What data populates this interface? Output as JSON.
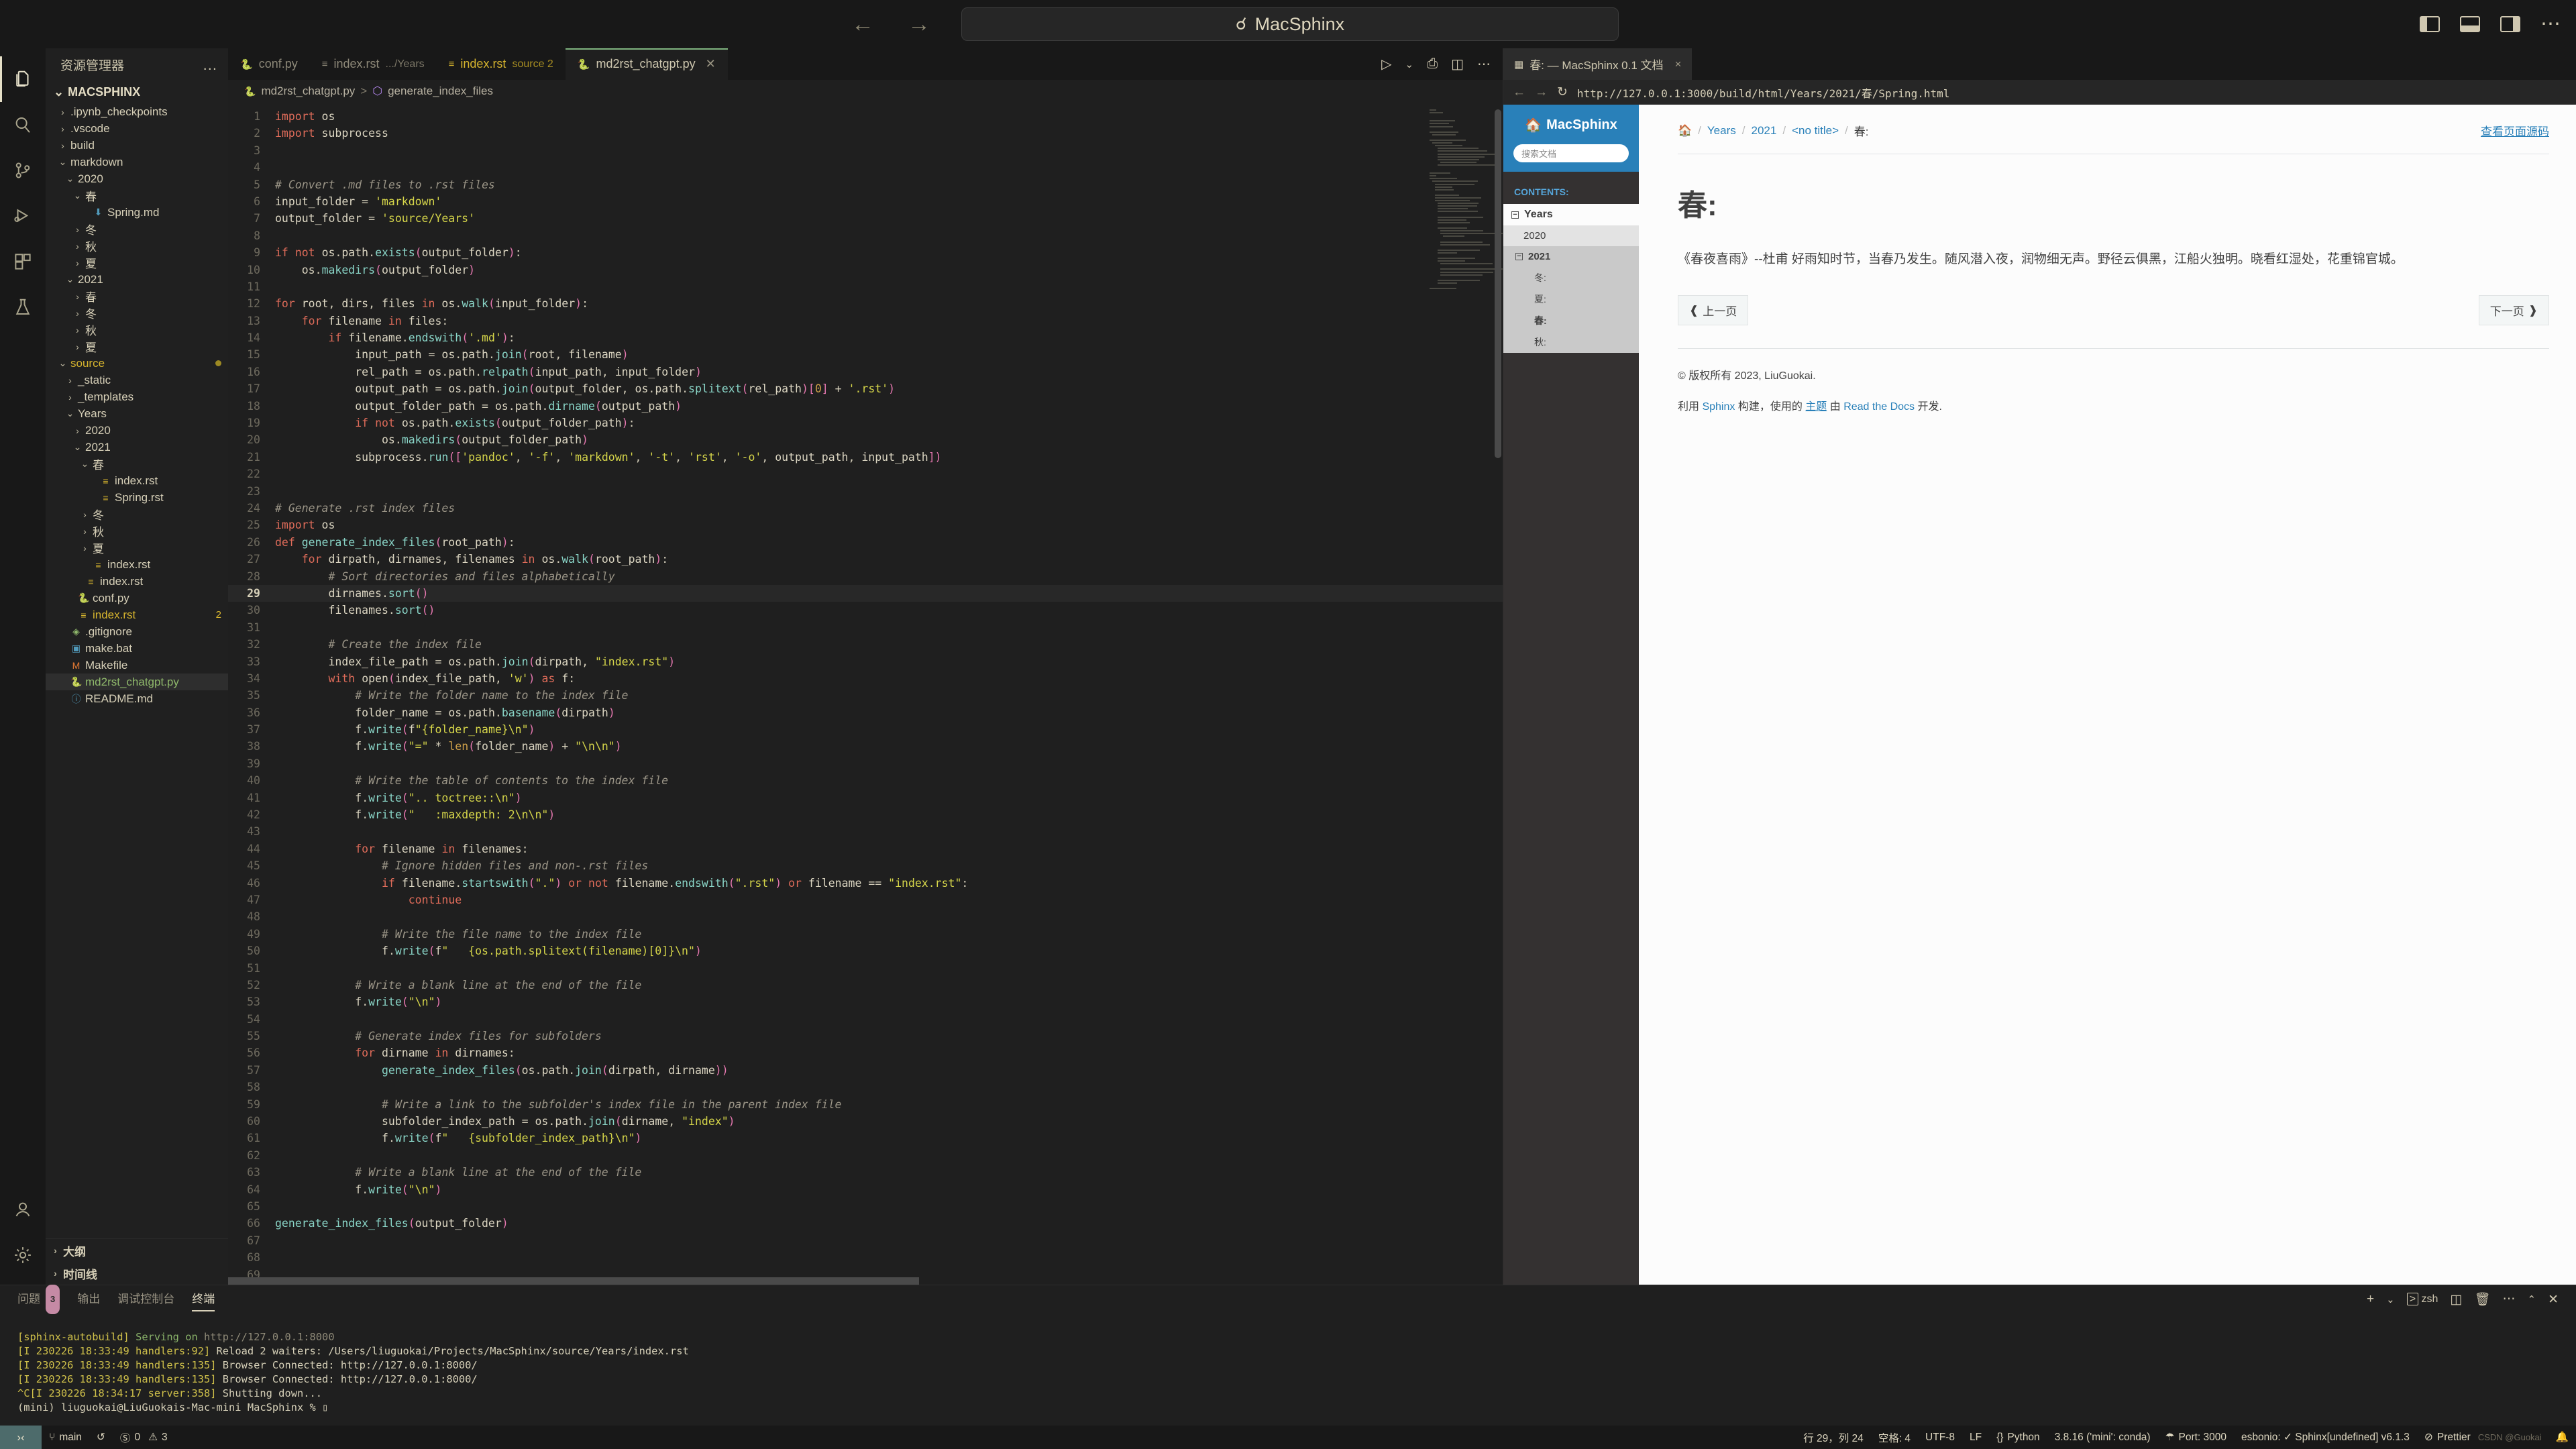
{
  "titlebar": {
    "back_icon": "back-arrow-icon",
    "forward_icon": "forward-arrow-icon",
    "search_placeholder": "MacSphinx",
    "search_icon": "search-icon"
  },
  "activitybar": {
    "items": [
      {
        "name": "explorer",
        "icon": "files-icon"
      },
      {
        "name": "search",
        "icon": "search-icon"
      },
      {
        "name": "source-control",
        "icon": "source-control-icon"
      },
      {
        "name": "run-debug",
        "icon": "run-debug-icon"
      },
      {
        "name": "extensions",
        "icon": "extensions-icon"
      },
      {
        "name": "testing",
        "icon": "beaker-icon"
      }
    ],
    "bottom": [
      {
        "name": "accounts",
        "icon": "account-icon"
      },
      {
        "name": "settings",
        "icon": "gear-icon"
      }
    ]
  },
  "explorer": {
    "title": "资源管理器",
    "more_label": "...",
    "root": "MACSPHINX",
    "tree": [
      {
        "label": ".ipynb_checkpoints",
        "kind": "folder",
        "depth": 1,
        "state": "collapsed"
      },
      {
        "label": ".vscode",
        "kind": "folder",
        "depth": 1,
        "state": "collapsed"
      },
      {
        "label": "build",
        "kind": "folder",
        "depth": 1,
        "state": "collapsed"
      },
      {
        "label": "markdown",
        "kind": "folder",
        "depth": 1,
        "state": "expanded"
      },
      {
        "label": "2020",
        "kind": "folder",
        "depth": 2,
        "state": "expanded"
      },
      {
        "label": "春",
        "kind": "folder",
        "depth": 3,
        "state": "expanded"
      },
      {
        "label": "Spring.md",
        "kind": "markdown",
        "depth": 4,
        "state": "file"
      },
      {
        "label": "冬",
        "kind": "folder",
        "depth": 3,
        "state": "collapsed"
      },
      {
        "label": "秋",
        "kind": "folder",
        "depth": 3,
        "state": "collapsed"
      },
      {
        "label": "夏",
        "kind": "folder",
        "depth": 3,
        "state": "collapsed"
      },
      {
        "label": "2021",
        "kind": "folder",
        "depth": 2,
        "state": "expanded"
      },
      {
        "label": "春",
        "kind": "folder",
        "depth": 3,
        "state": "collapsed"
      },
      {
        "label": "冬",
        "kind": "folder",
        "depth": 3,
        "state": "collapsed"
      },
      {
        "label": "秋",
        "kind": "folder",
        "depth": 3,
        "state": "collapsed"
      },
      {
        "label": "夏",
        "kind": "folder",
        "depth": 3,
        "state": "collapsed"
      },
      {
        "label": "source",
        "kind": "folder",
        "depth": 1,
        "state": "expanded",
        "modified": true
      },
      {
        "label": "_static",
        "kind": "folder",
        "depth": 2,
        "state": "collapsed"
      },
      {
        "label": "_templates",
        "kind": "folder",
        "depth": 2,
        "state": "collapsed"
      },
      {
        "label": "Years",
        "kind": "folder",
        "depth": 2,
        "state": "expanded"
      },
      {
        "label": "2020",
        "kind": "folder",
        "depth": 3,
        "state": "collapsed"
      },
      {
        "label": "2021",
        "kind": "folder",
        "depth": 3,
        "state": "expanded"
      },
      {
        "label": "春",
        "kind": "folder",
        "depth": 4,
        "state": "expanded"
      },
      {
        "label": "index.rst",
        "kind": "rst",
        "depth": 5,
        "state": "file"
      },
      {
        "label": "Spring.rst",
        "kind": "rst",
        "depth": 5,
        "state": "file"
      },
      {
        "label": "冬",
        "kind": "folder",
        "depth": 4,
        "state": "collapsed"
      },
      {
        "label": "秋",
        "kind": "folder",
        "depth": 4,
        "state": "collapsed"
      },
      {
        "label": "夏",
        "kind": "folder",
        "depth": 4,
        "state": "collapsed"
      },
      {
        "label": "index.rst",
        "kind": "rst",
        "depth": 4,
        "state": "file"
      },
      {
        "label": "index.rst",
        "kind": "rst",
        "depth": 3,
        "state": "file"
      },
      {
        "label": "conf.py",
        "kind": "python",
        "depth": 2,
        "state": "file"
      },
      {
        "label": "index.rst",
        "kind": "rst",
        "depth": 2,
        "state": "file",
        "badge": "2",
        "modified": true
      },
      {
        "label": ".gitignore",
        "kind": "git",
        "depth": 1,
        "state": "file"
      },
      {
        "label": "make.bat",
        "kind": "bat",
        "depth": 1,
        "state": "file"
      },
      {
        "label": "Makefile",
        "kind": "makefile",
        "depth": 1,
        "state": "file"
      },
      {
        "label": "md2rst_chatgpt.py",
        "kind": "python",
        "depth": 1,
        "state": "file",
        "selected": true,
        "active": true
      },
      {
        "label": "README.md",
        "kind": "readme",
        "depth": 1,
        "state": "file"
      }
    ],
    "bottom_sections": [
      {
        "label": "大纲",
        "state": "collapsed"
      },
      {
        "label": "时间线",
        "state": "collapsed"
      }
    ]
  },
  "editor": {
    "tabs": [
      {
        "label": "conf.py",
        "icon": "python-icon",
        "detail": "",
        "active": false,
        "modified": false
      },
      {
        "label": "index.rst",
        "icon": "rst-icon",
        "detail": ".../Years",
        "active": false,
        "modified": false
      },
      {
        "label": "index.rst",
        "icon": "rst-icon",
        "detail": "source 2",
        "active": false,
        "modified": true
      },
      {
        "label": "md2rst_chatgpt.py",
        "icon": "python-icon",
        "detail": "",
        "active": true,
        "modified": false
      }
    ],
    "tab_actions": [
      {
        "name": "run-button",
        "icon": "play-icon"
      },
      {
        "name": "run-dropdown",
        "icon": "chevron-down-icon"
      },
      {
        "name": "split-terminal-button",
        "icon": "terminal-split-icon"
      },
      {
        "name": "split-editor-button",
        "icon": "split-editor-icon"
      },
      {
        "name": "more-actions-button",
        "icon": "ellipsis-icon"
      }
    ],
    "breadcrumb": {
      "file": "md2rst_chatgpt.py",
      "separator": ">",
      "symbol": "generate_index_files",
      "symbol_icon": "cube-icon"
    },
    "cursor_line": 29,
    "total_lines": 69,
    "code_lines": [
      "import os",
      "import subprocess",
      "",
      "",
      "# Convert .md files to .rst files",
      "input_folder = 'markdown'",
      "output_folder = 'source/Years'",
      "",
      "if not os.path.exists(output_folder):",
      "    os.makedirs(output_folder)",
      "",
      "for root, dirs, files in os.walk(input_folder):",
      "    for filename in files:",
      "        if filename.endswith('.md'):",
      "            input_path = os.path.join(root, filename)",
      "            rel_path = os.path.relpath(input_path, input_folder)",
      "            output_path = os.path.join(output_folder, os.path.splitext(rel_path)[0] + '.rst')",
      "            output_folder_path = os.path.dirname(output_path)",
      "            if not os.path.exists(output_folder_path):",
      "                os.makedirs(output_folder_path)",
      "            subprocess.run(['pandoc', '-f', 'markdown', '-t', 'rst', '-o', output_path, input_path])",
      "",
      "",
      "# Generate .rst index files",
      "import os",
      "def generate_index_files(root_path):",
      "    for dirpath, dirnames, filenames in os.walk(root_path):",
      "        # Sort directories and files alphabetically",
      "        dirnames.sort()",
      "        filenames.sort()",
      "",
      "        # Create the index file",
      "        index_file_path = os.path.join(dirpath, \"index.rst\")",
      "        with open(index_file_path, 'w') as f:",
      "            # Write the folder name to the index file",
      "            folder_name = os.path.basename(dirpath)",
      "            f.write(f\"{folder_name}\\n\")",
      "            f.write(\"=\" * len(folder_name) + \"\\n\\n\")",
      "",
      "            # Write the table of contents to the index file",
      "            f.write(\".. toctree::\\n\")",
      "            f.write(\"   :maxdepth: 2\\n\\n\")",
      "",
      "            for filename in filenames:",
      "                # Ignore hidden files and non-.rst files",
      "                if filename.startswith(\".\") or not filename.endswith(\".rst\") or filename == \"index.rst\":",
      "                    continue",
      "",
      "                # Write the file name to the index file",
      "                f.write(f\"   {os.path.splitext(filename)[0]}\\n\")",
      "",
      "            # Write a blank line at the end of the file",
      "            f.write(\"\\n\")",
      "",
      "            # Generate index files for subfolders",
      "            for dirname in dirnames:",
      "                generate_index_files(os.path.join(dirpath, dirname))",
      "",
      "                # Write a link to the subfolder's index file in the parent index file",
      "                subfolder_index_path = os.path.join(dirname, \"index\")",
      "                f.write(f\"   {subfolder_index_path}\\n\")",
      "",
      "            # Write a blank line at the end of the file",
      "            f.write(\"\\n\")",
      "",
      "generate_index_files(output_folder)",
      "",
      "",
      ""
    ]
  },
  "preview": {
    "tab_label": "春: — MacSphinx 0.1 文档",
    "tab_icon": "browser-preview-icon",
    "tab_close": "×",
    "back_icon": "back-arrow-icon",
    "forward_icon": "forward-arrow-icon",
    "reload_icon": "reload-icon",
    "url": "http://127.0.0.1:3000/build/html/Years/2021/春/Spring.html",
    "sphinx": {
      "brand": "MacSphinx",
      "brand_icon": "home-icon",
      "search_placeholder": "搜索文档",
      "contents_caption": "CONTENTS:",
      "nav": [
        {
          "label": "Years",
          "level": 1,
          "state": "expanded",
          "toggle": "−"
        },
        {
          "label": "2020",
          "level": 2,
          "state": "leaf"
        },
        {
          "label": "2021",
          "level": 2,
          "state": "expanded",
          "toggle": "−"
        },
        {
          "label": "冬:",
          "level": 3,
          "state": "leaf"
        },
        {
          "label": "夏:",
          "level": 3,
          "state": "leaf"
        },
        {
          "label": "春:",
          "level": 3,
          "state": "current"
        },
        {
          "label": "秋:",
          "level": 3,
          "state": "leaf"
        }
      ],
      "breadcrumbs": [
        {
          "label": "home-icon",
          "type": "icon"
        },
        {
          "label": "Years",
          "type": "link"
        },
        {
          "label": "2021",
          "type": "link"
        },
        {
          "label": "<no title>",
          "type": "link"
        },
        {
          "label": "春:",
          "type": "current"
        }
      ],
      "view_source": "查看页面源码",
      "heading": "春:",
      "paragraph": "《春夜喜雨》--杜甫 好雨知时节，当春乃发生。随风潜入夜，润物细无声。野径云俱黑，江船火独明。晓看红湿处，花重锦官城。",
      "prev_button": "上一页",
      "prev_icon": "circle-left-icon",
      "next_button": "下一页",
      "next_icon": "circle-right-icon",
      "copyright": "© 版权所有 2023, LiuGuokai.",
      "footer_parts": {
        "p1": "利用 ",
        "sphinx": "Sphinx",
        "p2": " 构建，使用的 ",
        "theme": "主题",
        "p3": " 由 ",
        "rtd": "Read the Docs",
        "p4": " 开发."
      }
    }
  },
  "panel": {
    "tabs": [
      {
        "label": "问题",
        "badge": "3",
        "active": false
      },
      {
        "label": "输出",
        "badge": "",
        "active": false
      },
      {
        "label": "调试控制台",
        "badge": "",
        "active": false
      },
      {
        "label": "终端",
        "badge": "",
        "active": true
      }
    ],
    "actions": [
      {
        "name": "new-terminal-button",
        "icon": "plus-icon"
      },
      {
        "name": "terminal-dropdown",
        "icon": "chevron-down-icon"
      },
      {
        "name": "shell-indicator",
        "icon": "terminal-icon",
        "label": "zsh"
      },
      {
        "name": "split-terminal-button",
        "icon": "split-icon"
      },
      {
        "name": "kill-terminal-button",
        "icon": "trash-icon"
      },
      {
        "name": "panel-more-button",
        "icon": "ellipsis-icon"
      },
      {
        "name": "maximize-panel-button",
        "icon": "chevron-up-icon"
      },
      {
        "name": "close-panel-button",
        "icon": "close-icon"
      }
    ],
    "terminal_lines": [
      {
        "type": "autobuild",
        "prefix": "[sphinx-autobuild]",
        "body": " Serving on ",
        "url": "http://127.0.0.1:8000"
      },
      {
        "type": "log",
        "prefix": "[I 230226 18:33:49 handlers:92]",
        "body": " Reload 2 waiters: /Users/liuguokai/Projects/MacSphinx/source/Years/index.rst"
      },
      {
        "type": "log",
        "prefix": "[I 230226 18:33:49 handlers:135]",
        "body": " Browser Connected: http://127.0.0.1:8000/"
      },
      {
        "type": "log",
        "prefix": "[I 230226 18:33:49 handlers:135]",
        "body": " Browser Connected: http://127.0.0.1:8000/"
      },
      {
        "type": "interrupt",
        "prefix": "^C[I 230226 18:34:17 server:358]",
        "body": " Shutting down..."
      },
      {
        "type": "prompt",
        "prefix": "(mini) liuguokai@LiuGuokais-Mac-mini MacSphinx % ",
        "body": ""
      }
    ]
  },
  "statusbar": {
    "remote_icon": "remote-indicator-icon",
    "left": [
      {
        "name": "branch",
        "icon": "git-branch-icon",
        "label": "main"
      },
      {
        "name": "sync",
        "icon": "sync-icon",
        "label": ""
      },
      {
        "name": "problems",
        "icon": "error-warning-icon",
        "label": "0  3",
        "errors": "0",
        "warnings": "3"
      }
    ],
    "right": [
      {
        "name": "cursor-position",
        "label": "行 29，列 24"
      },
      {
        "name": "indentation",
        "label": "空格: 4"
      },
      {
        "name": "encoding",
        "label": "UTF-8"
      },
      {
        "name": "eol",
        "label": "LF"
      },
      {
        "name": "language-mode",
        "label": "Python",
        "icon": "python-icon"
      },
      {
        "name": "interpreter",
        "label": "3.8.16 ('mini': conda)"
      },
      {
        "name": "live-server-port",
        "label": "Port: 3000",
        "icon": "broadcast-icon"
      },
      {
        "name": "esbonio",
        "label": "esbonio: ✓ Sphinx[undefined] v6.1.3"
      },
      {
        "name": "prettier",
        "label": "Prettier",
        "icon": "prohibited-icon"
      },
      {
        "name": "notifications",
        "label": "",
        "icon": "bell-icon"
      }
    ],
    "watermark": "CSDN @Guokai"
  }
}
